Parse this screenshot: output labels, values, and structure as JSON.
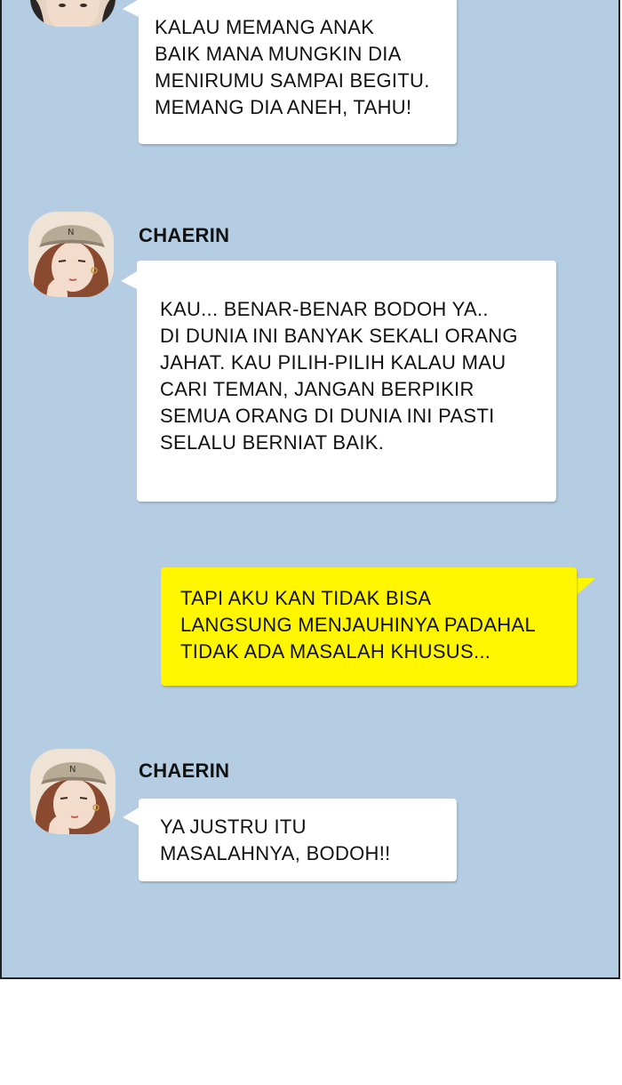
{
  "messages": [
    {
      "lines": [
        "KALAU MEMANG ANAK",
        "BAIK MANA MUNGKIN DIA",
        "MENIRUMU SAMPAI BEGITU.",
        "MEMANG DIA ANEH, TAHU!"
      ]
    },
    {
      "sender": "CHAERIN",
      "lines": [
        "KAU... BENAR-BENAR BODOH YA..",
        "DI DUNIA INI BANYAK SEKALI ORANG",
        "JAHAT. KAU PILIH-PILIH KALAU MAU",
        "CARI TEMAN, JANGAN BERPIKIR",
        "SEMUA ORANG DI DUNIA INI PASTI",
        "SELALU BERNIAT BAIK."
      ]
    },
    {
      "lines": [
        "TAPI AKU KAN TIDAK BISA",
        "LANGSUNG MENJAUHINYA PADAHAL",
        "TIDAK ADA MASALAH KHUSUS..."
      ]
    },
    {
      "sender": "CHAERIN",
      "lines": [
        "YA JUSTRU ITU",
        "MASALAHNYA, BODOH!!"
      ]
    }
  ],
  "colors": {
    "chat_background": "#b5cde3",
    "incoming_bubble": "#ffffff",
    "outgoing_bubble": "#fff600"
  },
  "icons": {
    "avatar_top": "avatar-icon",
    "avatar_chaerin": "avatar-chaerin-icon"
  }
}
